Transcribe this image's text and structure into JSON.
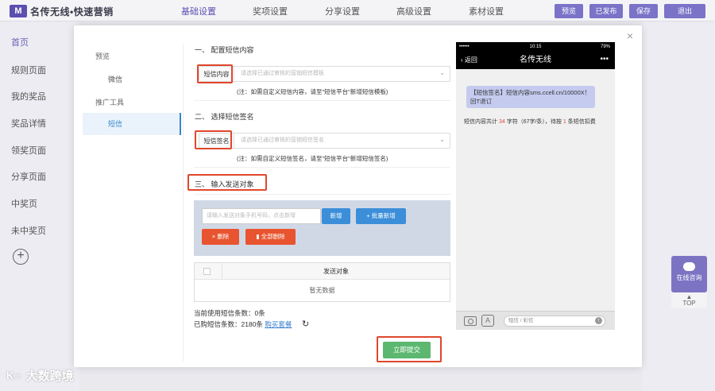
{
  "header": {
    "logo_mark": "M",
    "logo_text": "名传无线•快速营销",
    "tabs": [
      "基础设置",
      "奖项设置",
      "分享设置",
      "高级设置",
      "素材设置"
    ],
    "active_tab": 0,
    "buttons": [
      "预览",
      "已发布",
      "保存",
      "退出"
    ]
  },
  "left_nav": {
    "items": [
      "首页",
      "规则页面",
      "我的奖品",
      "奖品详情",
      "领奖页面",
      "分享页面",
      "中奖页",
      "未中奖页"
    ]
  },
  "modal": {
    "close_glyph": "×",
    "menu": {
      "group_preview": "预览",
      "item_wechat": "微信",
      "group_promo": "推广工具",
      "item_sms": "短信"
    },
    "sec1": {
      "title": "一、 配置短信内容",
      "label": "短信内容",
      "placeholder": "请选择已通过审核的营销短信模板",
      "note": "(注：如需自定义短信内容，请至\"短信平台\"新增短信模板)"
    },
    "sec2": {
      "title": "二、 选择短信签名",
      "label": "短信签名",
      "placeholder": "请选择已通过审核的营销短信签名",
      "note": "(注：如需自定义短信签名，请至\"短信平台\"新增短信签名)"
    },
    "sec3": {
      "title": "三、 输入发送对象",
      "input_placeholder": "请输入发送对象手机号码，点击新增",
      "add_btn": "新增",
      "batch_add_btn": "+ 批量新增",
      "delete_btn": "× 删除",
      "delete_all_btn": "全部删除"
    },
    "table": {
      "column": "发送对象",
      "empty": "暂无数据"
    },
    "stats": {
      "used_label": "当前使用短信条数：",
      "used_value": "0条",
      "bought_label": "已购短信条数：",
      "bought_value": "2180条",
      "buy_link": "购买套餐",
      "refresh_icon": "↻"
    },
    "submit": "立即提交"
  },
  "phone": {
    "carrier": "•••••• ",
    "time": "10:15",
    "battery": "79%",
    "back": "返回",
    "title": "名传无线",
    "more": "•••",
    "bubble_text": "【短信签名】短信内容sms.ccell.cn/10000X！回T退订",
    "count_pre": "短信内容共计 ",
    "count_chars": "34",
    "count_mid": " 字符（67字/条），待按 ",
    "count_msgs": "1",
    "count_post": " 条短信扣费",
    "input_placeholder": "短信 / 彩信",
    "app_glyph": "A"
  },
  "float": {
    "chat_label": "在线咨询",
    "top_label": "TOP"
  },
  "watermark": {
    "icon": "K∞",
    "text": "大数跨境"
  },
  "colors": {
    "accent": "#5b4fb0",
    "blue": "#3c8ed8",
    "orange": "#e8542f",
    "green": "#5cb870",
    "highlight_red": "#e0472c"
  }
}
